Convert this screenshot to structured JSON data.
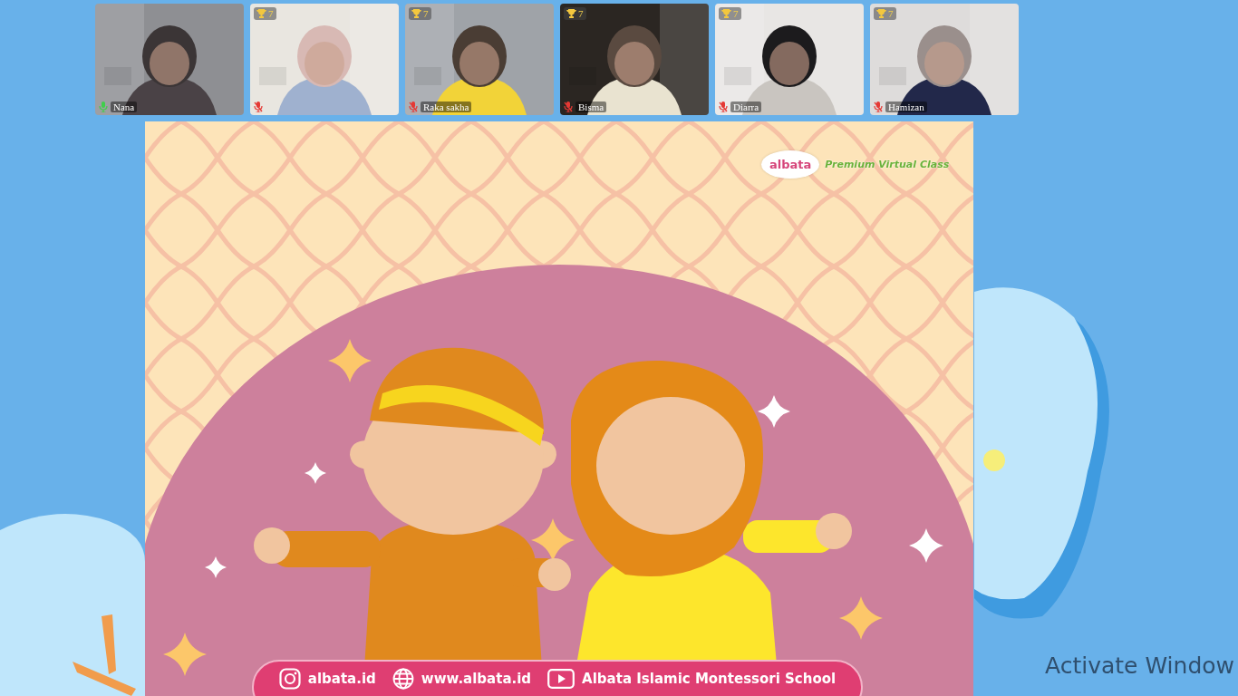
{
  "participants": [
    {
      "name": "Nana",
      "muted": false
    },
    {
      "score": "7",
      "muted": true
    },
    {
      "name": "Raka sakha",
      "score": "7",
      "muted": true
    },
    {
      "name": "Bisma",
      "score": "7",
      "muted": true
    },
    {
      "name": "Diarra",
      "score": "7",
      "muted": true
    },
    {
      "name": "Hamizan",
      "score": "7",
      "muted": true
    }
  ],
  "slide": {
    "logo": "albata",
    "tagline": "Premium Virtual Class",
    "links": [
      {
        "kind": "instagram",
        "text": "albata.id"
      },
      {
        "kind": "web",
        "text": "www.albata.id"
      },
      {
        "kind": "youtube",
        "text": "Albata Islamic Montessori School"
      }
    ]
  },
  "os_notice": {
    "title": "Activate Window"
  }
}
